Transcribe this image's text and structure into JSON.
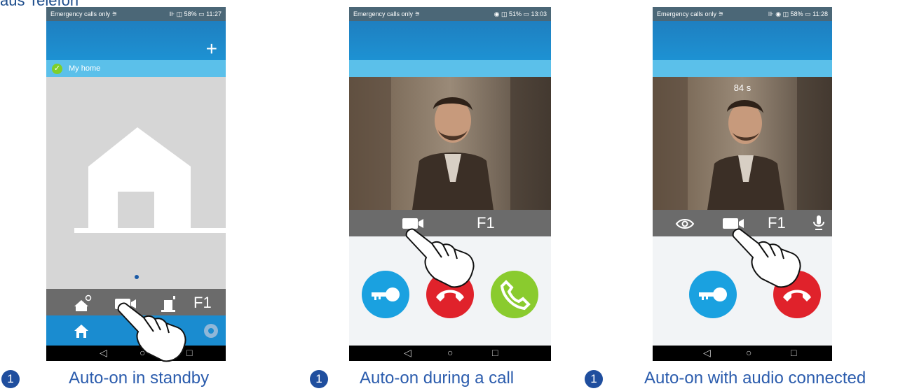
{
  "top_title": "aus Telefon",
  "phones": [
    {
      "status_left": "Emergency calls only ⚞",
      "status_right": "⊪ ◫ 58% ▭ 11:27",
      "plus_label": "+",
      "home_label": "My home",
      "f1_label": "F1",
      "caption_num": "1",
      "caption": "Auto-on in standby"
    },
    {
      "status_left": "Emergency calls only ⚞",
      "status_right": "◉ ◫ 51% ▭ 13:03",
      "f1_label": "F1",
      "caption_num": "1",
      "caption": "Auto-on during a call"
    },
    {
      "status_left": "Emergency calls only ⚞",
      "status_right": "⊪ ◉ ◫ 58% ▭ 11:28",
      "timer": "84 s",
      "f1_label": "F1",
      "caption_num": "1",
      "caption": "Auto-on with audio connected"
    }
  ],
  "nav": {
    "back": "◁",
    "home": "○",
    "recent": "□"
  },
  "colors": {
    "appbar": "#1d92d3",
    "subbar": "#5bc0ea",
    "ctrlbar": "#6b6b6b",
    "tabbar": "#1a8cd0",
    "unlock": "#1aa1e0",
    "hangup": "#e0222b",
    "answer": "#8acb2e",
    "caption": "#2b5cad"
  },
  "icons": [
    "home-settings-icon",
    "camera-icon",
    "intercom-icon",
    "home-icon",
    "video-list-icon",
    "gear-icon",
    "key-icon",
    "hangup-icon",
    "phone-icon",
    "eye-icon",
    "microphone-icon",
    "pointing-hand-icon"
  ]
}
